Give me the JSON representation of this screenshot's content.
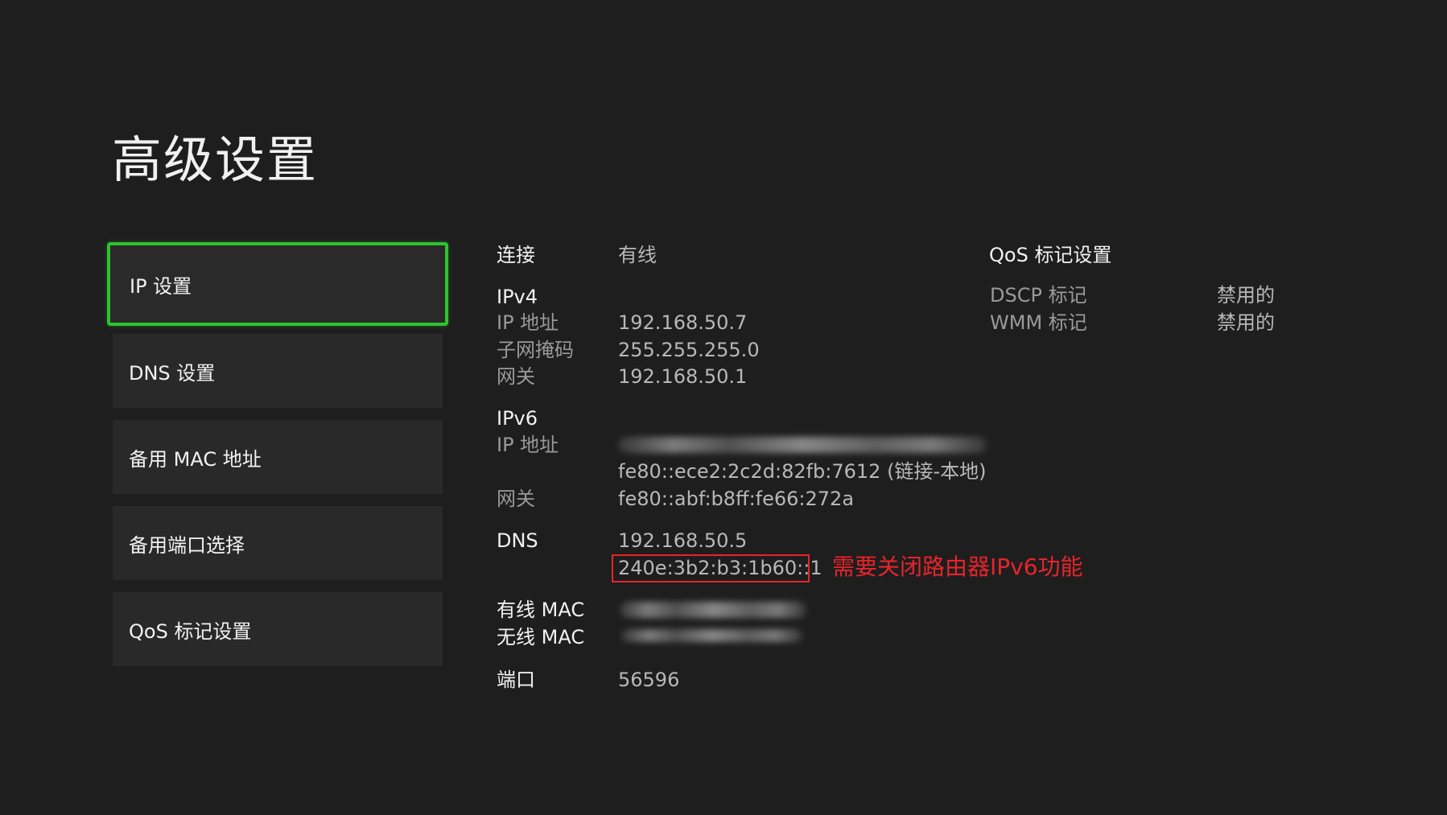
{
  "page": {
    "title": "高级设置"
  },
  "sidebar": {
    "items": [
      {
        "label": "IP 设置",
        "selected": true
      },
      {
        "label": "DNS 设置",
        "selected": false
      },
      {
        "label": "备用 MAC 地址",
        "selected": false
      },
      {
        "label": "备用端口选择",
        "selected": false
      },
      {
        "label": "QoS 标记设置",
        "selected": false
      }
    ],
    "accent_color": "#2fc22f"
  },
  "details": {
    "connection": {
      "label": "连接",
      "value": "有线"
    },
    "ipv4": {
      "heading": "IPv4",
      "ip_label": "IP 地址",
      "ip_value": "192.168.50.7",
      "subnet_label": "子网掩码",
      "subnet_value": "255.255.255.0",
      "gateway_label": "网关",
      "gateway_value": "192.168.50.1"
    },
    "ipv6": {
      "heading": "IPv6",
      "ip_label": "IP 地址",
      "ip_link_local": "fe80::ece2:2c2d:82fb:7612 (链接-本地)",
      "gateway_label": "网关",
      "gateway_value": "fe80::abf:b8ff:fe66:272a"
    },
    "dns": {
      "label": "DNS",
      "primary": "192.168.50.5",
      "secondary": "240e:3b2:b3:1b60::1"
    },
    "wired_mac_label": "有线 MAC",
    "wireless_mac_label": "无线 MAC",
    "port": {
      "label": "端口",
      "value": "56596"
    }
  },
  "qos": {
    "heading": "QoS 标记设置",
    "dscp_label": "DSCP 标记",
    "dscp_value": "禁用的",
    "wmm_label": "WMM 标记",
    "wmm_value": "禁用的"
  },
  "annotation": {
    "text": "需要关闭路由器IPv6功能",
    "color": "#e8242a"
  }
}
